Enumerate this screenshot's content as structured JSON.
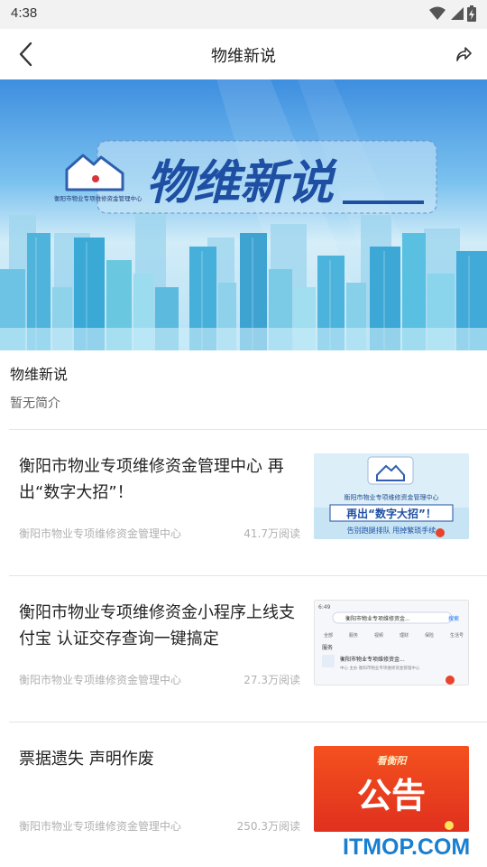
{
  "status_bar": {
    "time": "4:38",
    "icons": [
      "wifi-icon",
      "signal-icon",
      "battery-charging-icon"
    ]
  },
  "nav": {
    "title": "物维新说",
    "back_icon": "chevron-left-icon",
    "share_icon": "share-icon"
  },
  "banner": {
    "title": "物维新说",
    "org_name": "衡阳市物业专项维修资金管理中心",
    "colors": {
      "sky_top": "#3e8ee0",
      "sky_bottom": "#b7e2f5",
      "title": "#1f4fa3"
    }
  },
  "column": {
    "name": "物维新说",
    "intro": "暂无简介"
  },
  "articles": [
    {
      "title": "衡阳市物业专项维修资金管理中心 再出“数字大招”！",
      "source": "衡阳市物业专项维修资金管理中心",
      "reads": "41.7万阅读",
      "thumb": {
        "org": "衡阳市物业专项维修资金管理中心",
        "headline": "再出“数字大招”！",
        "caption": "告别跑腿排队 甩掉繁琐手续"
      }
    },
    {
      "title": "衡阳市物业专项维修资金小程序上线支付宝 认证交存查询一键搞定",
      "source": "衡阳市物业专项维修资金管理中心",
      "reads": "27.3万阅读",
      "thumb": {
        "status_time": "6:49",
        "search_text": "衡阳市物业专项维修资金...",
        "search_btn": "搜索",
        "tabs": [
          "全部",
          "服务",
          "视频",
          "理财",
          "保险",
          "生活号"
        ],
        "section": "服务",
        "result_title": "衡阳市物业专项维修资金...",
        "result_desc": "中心 主办 衡阳市物业专项维修资金管理中心"
      }
    },
    {
      "title": "票据遗失 声明作废",
      "source": "衡阳市物业专项维修资金管理中心",
      "reads": "250.3万阅读",
      "thumb": {
        "brand": "看衡阳",
        "headline": "公告"
      }
    }
  ],
  "watermark": "ITMOP.COM"
}
